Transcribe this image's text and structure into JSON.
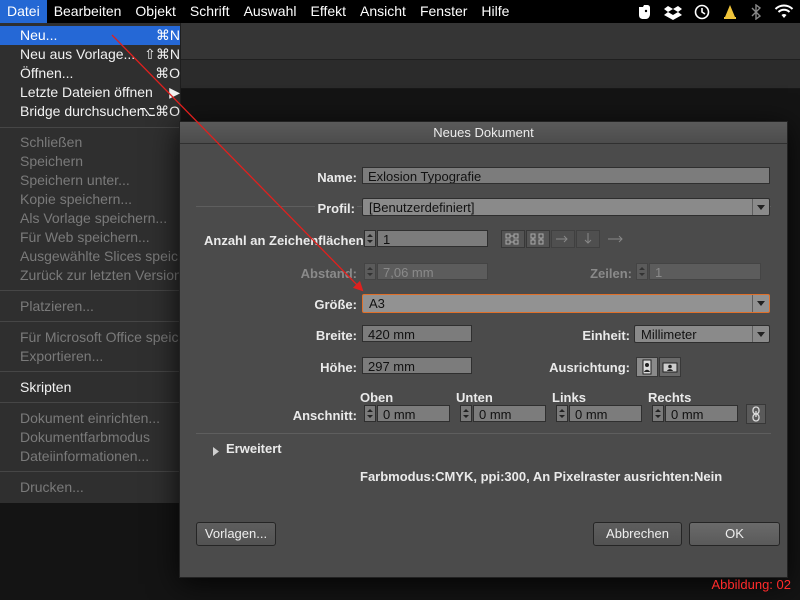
{
  "menubar": {
    "items": [
      "Datei",
      "Bearbeiten",
      "Objekt",
      "Schrift",
      "Auswahl",
      "Effekt",
      "Ansicht",
      "Fenster",
      "Hilfe"
    ]
  },
  "status_icons": [
    "evernote-icon",
    "dropbox-icon",
    "timemachine-icon",
    "vlc-icon",
    "bluetooth-icon",
    "wifi-icon"
  ],
  "datei_menu": {
    "items": [
      {
        "label": "Neu...",
        "shortcut": "⌘N"
      },
      {
        "label": "Neu aus Vorlage...",
        "shortcut": "⇧⌘N"
      },
      {
        "label": "Öffnen...",
        "shortcut": "⌘O"
      },
      {
        "label": "Letzte Dateien öffnen",
        "shortcut": "▶"
      },
      {
        "label": "Bridge durchsuchen...",
        "shortcut": "⌥⌘O"
      },
      {
        "label": "Schließen",
        "shortcut": ""
      },
      {
        "label": "Speichern",
        "shortcut": ""
      },
      {
        "label": "Speichern unter...",
        "shortcut": ""
      },
      {
        "label": "Kopie speichern...",
        "shortcut": ""
      },
      {
        "label": "Als Vorlage speichern...",
        "shortcut": ""
      },
      {
        "label": "Für Web speichern...",
        "shortcut": ""
      },
      {
        "label": "Ausgewählte Slices speichern...",
        "shortcut": ""
      },
      {
        "label": "Zurück zur letzten Version",
        "shortcut": ""
      },
      {
        "label": "Platzieren...",
        "shortcut": ""
      },
      {
        "label": "Für Microsoft Office speichern...",
        "shortcut": ""
      },
      {
        "label": "Exportieren...",
        "shortcut": ""
      },
      {
        "label": "Skripten",
        "shortcut": ""
      },
      {
        "label": "Dokument einrichten...",
        "shortcut": ""
      },
      {
        "label": "Dokumentfarbmodus",
        "shortcut": ""
      },
      {
        "label": "Dateiinformationen...",
        "shortcut": ""
      },
      {
        "label": "Drucken...",
        "shortcut": ""
      }
    ]
  },
  "dialog": {
    "title": "Neues Dokument",
    "name_label": "Name:",
    "name_value": "Exlosion Typografie",
    "profil_label": "Profil:",
    "profil_value": "[Benutzerdefiniert]",
    "artboards_label": "Anzahl an Zeichenflächen:",
    "artboards_value": "1",
    "abstand_label": "Abstand:",
    "abstand_value": "7,06 mm",
    "zeilen_label": "Zeilen:",
    "zeilen_value": "1",
    "groesse_label": "Größe:",
    "groesse_value": "A3",
    "breite_label": "Breite:",
    "breite_value": "420 mm",
    "einheit_label": "Einheit:",
    "einheit_value": "Millimeter",
    "hoehe_label": "Höhe:",
    "hoehe_value": "297 mm",
    "ausrichtung_label": "Ausrichtung:",
    "anschnitt_label": "Anschnitt:",
    "bleed": [
      {
        "label": "Oben",
        "value": "0 mm"
      },
      {
        "label": "Unten",
        "value": "0 mm"
      },
      {
        "label": "Links",
        "value": "0 mm"
      },
      {
        "label": "Rechts",
        "value": "0 mm"
      }
    ],
    "erweitert_label": "Erweitert",
    "info_text": "Farbmodus:CMYK, ppi:300, An Pixelraster ausrichten:Nein",
    "vorlagen_button": "Vorlagen...",
    "abbrechen_button": "Abbrechen",
    "ok_button": "OK"
  },
  "annotation": {
    "figure_label": "Abbildung: 02",
    "arrow_color": "#e0201e"
  },
  "colors": {
    "menu_highlight": "#2568d6",
    "focus_ring": "#e0702a",
    "dialog_bg": "#4b4b4b"
  }
}
